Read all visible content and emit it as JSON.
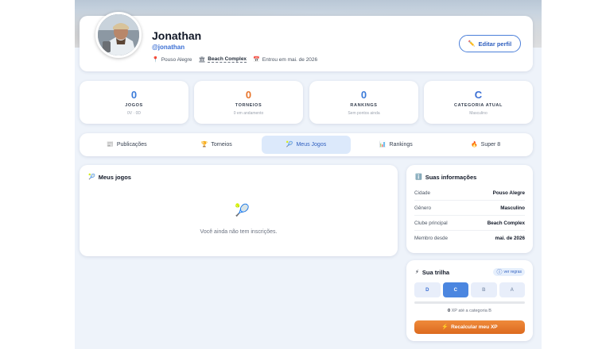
{
  "profile": {
    "name": "Jonathan",
    "handle": "@jonathan",
    "city": "Pouso Alegre",
    "club": "Beach Complex",
    "joined": "Entrou em mai. de 2026",
    "edit_label": "Editar perfil"
  },
  "stats": [
    {
      "value": "0",
      "label": "JOGOS",
      "sub": "0V · 0D",
      "color": "#3b7bd9"
    },
    {
      "value": "0",
      "label": "TORNEIOS",
      "sub": "0 em andamento",
      "color": "#e8742a"
    },
    {
      "value": "0",
      "label": "RANKINGS",
      "sub": "Sem pontos ainda",
      "color": "#3b7bd9"
    },
    {
      "value": "C",
      "label": "CATEGORIA ATUAL",
      "sub": "Masculino",
      "color": "#3b6fd4"
    }
  ],
  "tabs": [
    {
      "label": "Publicações",
      "icon": "📰"
    },
    {
      "label": "Torneios",
      "icon": "🏆"
    },
    {
      "label": "Meus Jogos",
      "icon": "🎾"
    },
    {
      "label": "Rankings",
      "icon": "📊"
    },
    {
      "label": "Super 8",
      "icon": "🔥"
    }
  ],
  "games": {
    "title": "Meus jogos",
    "empty": "Você ainda não tem inscrições."
  },
  "info": {
    "title": "Suas informações",
    "rows": [
      {
        "key": "Cidade",
        "value": "Pouso Alegre"
      },
      {
        "key": "Gênero",
        "value": "Masculino"
      },
      {
        "key": "Clube principal",
        "value": "Beach Complex"
      },
      {
        "key": "Membro desde",
        "value": "mai. de 2026"
      }
    ]
  },
  "trail": {
    "title": "Sua trilha",
    "rules_label": "ver regras",
    "levels": [
      "D",
      "C",
      "B",
      "A"
    ],
    "active_level": "C",
    "xp_value": "0",
    "xp_text": "XP até a categoria B",
    "progress_percent": 0,
    "recalc_label": "Recalcular meu XP"
  }
}
